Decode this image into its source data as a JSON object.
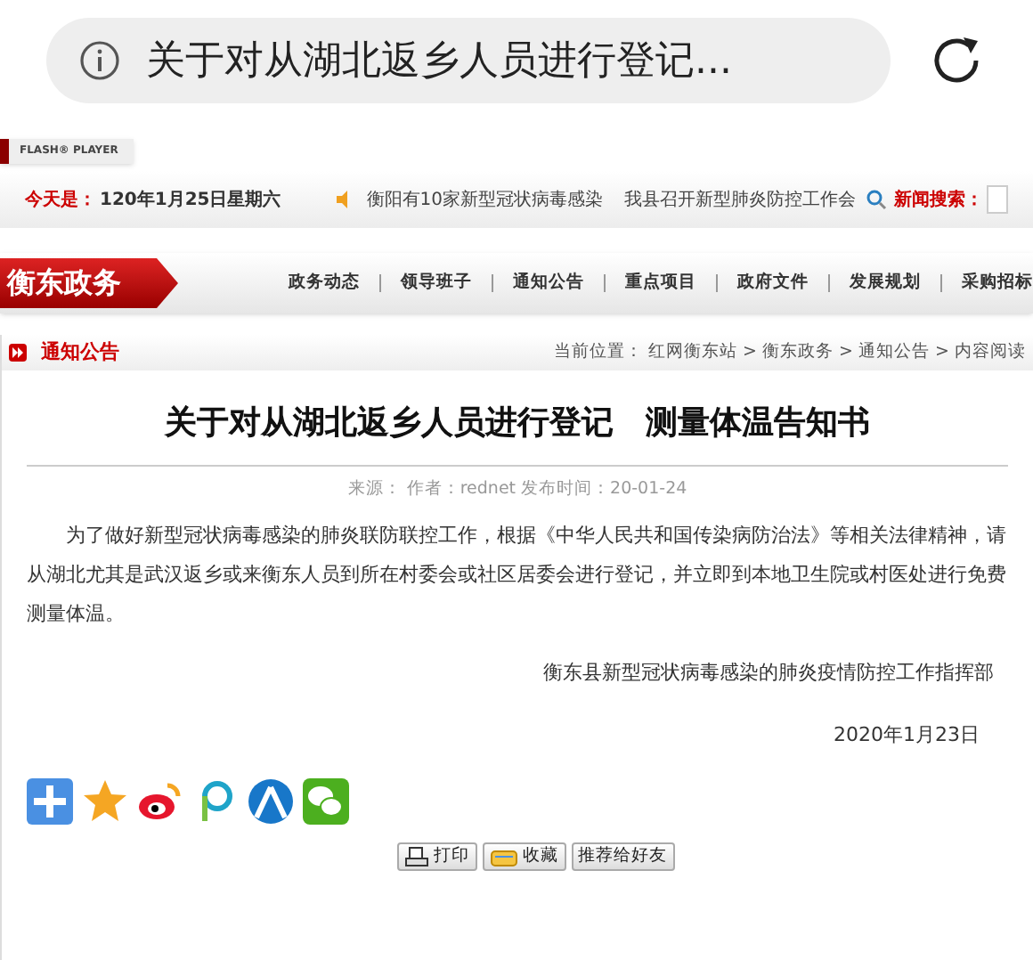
{
  "browser": {
    "title": "关于对从湖北返乡人员进行登记..."
  },
  "flash_label": "FLASH® PLAYER",
  "date_bar": {
    "label": "今天是：",
    "date": "120年1月25日星期六",
    "news": [
      "衡阳有10家新型冠状病毒感染",
      "我县召开新型肺炎防控工作会"
    ],
    "search_label": "新闻搜索："
  },
  "banner": {
    "logo": "衡东政务",
    "nav": [
      "政务动态",
      "领导班子",
      "通知公告",
      "重点项目",
      "政府文件",
      "发展规划",
      "采购招标"
    ]
  },
  "section": {
    "title": "通知公告",
    "breadcrumb": "当前位置： 红网衡东站 > 衡东政务 > 通知公告 > 内容阅读"
  },
  "article": {
    "title": "关于对从湖北返乡人员进行登记　测量体温告知书",
    "meta": "来源：  作者：rednet 发布时间：20-01-24",
    "body": "为了做好新型冠状病毒感染的肺炎联防联控工作，根据《中华人民共和国传染病防治法》等相关法律精神，请从湖北尤其是武汉返乡或来衡东人员到所在村委会或社区居委会进行登记，并立即到本地卫生院或村医处进行免费测量体温。",
    "signature": "衡东县新型冠状病毒感染的肺炎疫情防控工作指挥部",
    "date": "2020年1月23日"
  },
  "share": [
    {
      "kind": "plus"
    },
    {
      "kind": "qzone"
    },
    {
      "kind": "weibo"
    },
    {
      "kind": "p"
    },
    {
      "kind": "renren"
    },
    {
      "kind": "wechat"
    }
  ],
  "buttons": [
    {
      "label": "打印",
      "kind": "print"
    },
    {
      "label": "收藏",
      "kind": "favorite"
    },
    {
      "label": "推荐给好友",
      "kind": "plain"
    }
  ]
}
